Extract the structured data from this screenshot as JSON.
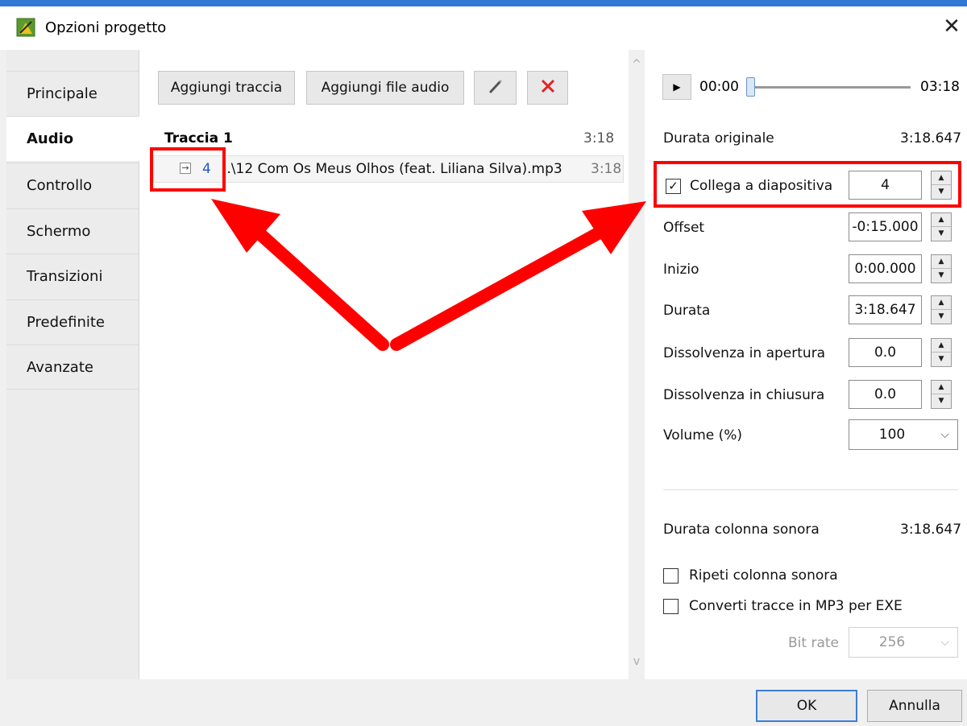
{
  "window": {
    "title": "Opzioni progetto",
    "close_glyph": "✕",
    "icon": "app-logo-icon"
  },
  "sidebar": {
    "items": [
      {
        "label": "Principale",
        "active": false
      },
      {
        "label": "Audio",
        "active": true
      },
      {
        "label": "Controllo",
        "active": false
      },
      {
        "label": "Schermo",
        "active": false
      },
      {
        "label": "Transizioni",
        "active": false
      },
      {
        "label": "Predefinite",
        "active": false
      },
      {
        "label": "Avanzate",
        "active": false
      }
    ]
  },
  "toolbar": {
    "add_track_label": "Aggiungi traccia",
    "add_audio_file_label": "Aggiungi file audio",
    "edit_icon": "pen-icon",
    "delete_icon": "red-x-icon"
  },
  "track": {
    "title": "Traccia 1",
    "duration": "3:18",
    "item": {
      "expand_glyph": "→",
      "slide_number": "4",
      "file_name": "..\\12 Com Os Meus Olhos (feat. Liliana Silva).mp3",
      "duration": "3:18"
    }
  },
  "player": {
    "play_glyph": "▶",
    "time_start": "00:00",
    "time_end": "03:18",
    "position_fraction": 0
  },
  "properties": {
    "original_duration_label": "Durata originale",
    "original_duration_value": "3:18.647",
    "link_to_slide_label": "Collega a diapositiva",
    "link_to_slide_checked": true,
    "link_to_slide_value": "4",
    "offset_label": "Offset",
    "offset_value": "-0:15.000",
    "start_label": "Inizio",
    "start_value": "0:00.000",
    "duration_label": "Durata",
    "duration_value": "3:18.647",
    "fade_in_label": "Dissolvenza in apertura",
    "fade_in_value": "0.0",
    "fade_out_label": "Dissolvenza in chiusura",
    "fade_out_value": "0.0",
    "volume_label": "Volume (%)",
    "volume_value": "100"
  },
  "soundtrack": {
    "duration_label": "Durata colonna sonora",
    "duration_value": "3:18.647",
    "repeat_label": "Ripeti colonna sonora",
    "repeat_checked": false,
    "convert_label": "Converti tracce in MP3 per EXE",
    "convert_checked": false,
    "bitrate_label": "Bit rate",
    "bitrate_value": "256"
  },
  "footer": {
    "ok_label": "OK",
    "cancel_label": "Annulla"
  },
  "annotations": {
    "highlight_color": "#ff0000",
    "accent_color": "#2f78d4"
  },
  "glyphs": {
    "spin_up": "▲",
    "spin_down": "▼",
    "chevron_down": "⌵",
    "check": "✓",
    "scroll_up": "^",
    "scroll_down": "v"
  }
}
